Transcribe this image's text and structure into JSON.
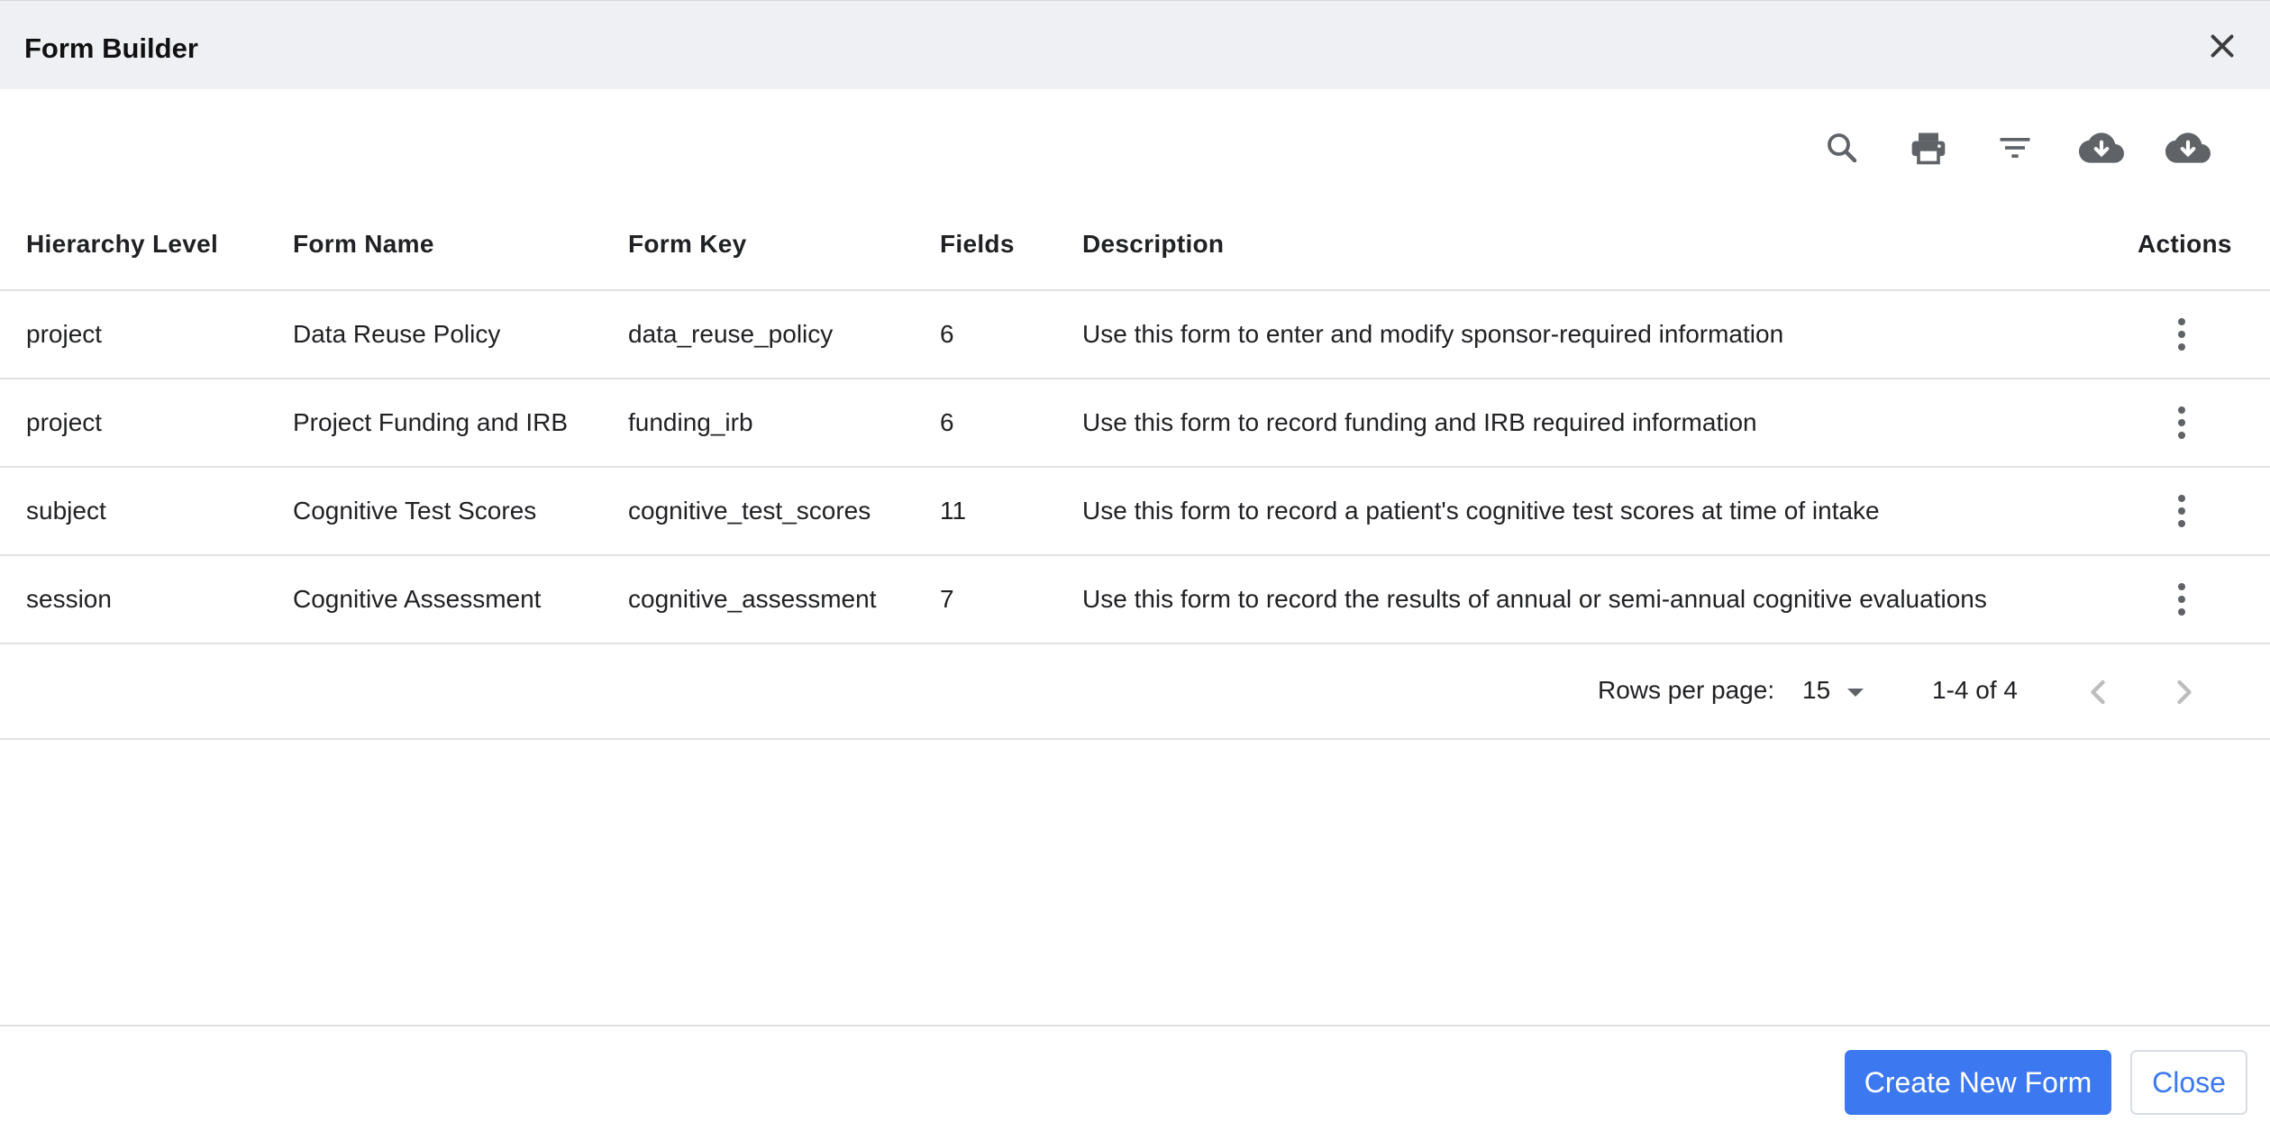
{
  "dialog": {
    "title": "Form Builder"
  },
  "toolbar": {
    "icons": [
      "search-icon",
      "print-icon",
      "filter-icon",
      "cloud-download-icon",
      "cloud-download-icon"
    ]
  },
  "table": {
    "columns": [
      "Hierarchy Level",
      "Form Name",
      "Form Key",
      "Fields",
      "Description",
      "Actions"
    ],
    "rows": [
      [
        "project",
        "Data Reuse Policy",
        "data_reuse_policy",
        "6",
        "Use this form to enter and modify sponsor-required information"
      ],
      [
        "project",
        "Project Funding and IRB",
        "funding_irb",
        "6",
        "Use this form to record funding and IRB required information"
      ],
      [
        "subject",
        "Cognitive Test Scores",
        "cognitive_test_scores",
        "11",
        "Use this form to record a patient's cognitive test scores at time of intake"
      ],
      [
        "session",
        "Cognitive Assessment",
        "cognitive_assessment",
        "7",
        "Use this form to record the results of annual or semi-annual cognitive evaluations"
      ]
    ]
  },
  "pagination": {
    "rows_per_page_label": "Rows per page:",
    "rows_per_page_value": "15",
    "range_text": "1-4 of 4"
  },
  "footer": {
    "create_label": "Create New Form",
    "close_label": "Close"
  },
  "colors": {
    "primary": "#3c78f0",
    "titlebar": "#eff0f3",
    "icon": "#5f6368"
  }
}
